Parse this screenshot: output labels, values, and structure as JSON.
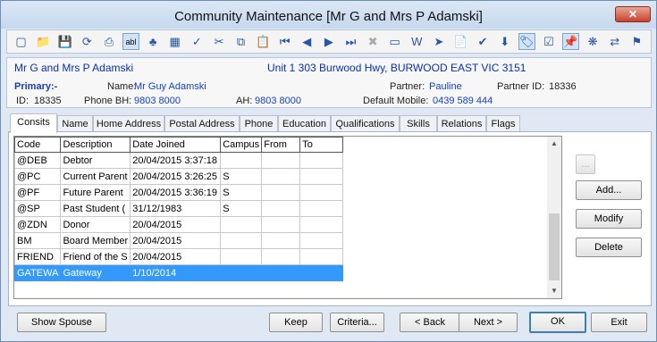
{
  "window": {
    "title": "Community Maintenance  [Mr G and Mrs P Adamski]",
    "close_label": "✕"
  },
  "toolbar": [
    {
      "name": "new-icon",
      "glyph": "▢"
    },
    {
      "name": "open-folder-icon",
      "glyph": "📁"
    },
    {
      "name": "save-icon",
      "glyph": "💾",
      "disabled": true
    },
    {
      "name": "refresh-icon",
      "glyph": "⟳"
    },
    {
      "name": "print-icon",
      "glyph": "⎙"
    },
    {
      "name": "abl-icon",
      "glyph": "abl",
      "pressed": true
    },
    {
      "name": "tree-icon",
      "glyph": "♣"
    },
    {
      "name": "calculator-icon",
      "glyph": "▦"
    },
    {
      "name": "spellcheck-icon",
      "glyph": "✓"
    },
    {
      "name": "cut-icon",
      "glyph": "✂"
    },
    {
      "name": "copy-icon",
      "glyph": "⧉"
    },
    {
      "name": "paste-icon",
      "glyph": "📋"
    },
    {
      "name": "first-record-icon",
      "glyph": "⏮"
    },
    {
      "name": "previous-record-icon",
      "glyph": "◀"
    },
    {
      "name": "next-record-icon",
      "glyph": "▶"
    },
    {
      "name": "last-record-icon",
      "glyph": "⏭"
    },
    {
      "name": "delete-icon",
      "glyph": "✖",
      "disabled": true
    },
    {
      "name": "card-icon",
      "glyph": "▭"
    },
    {
      "name": "word-document-icon",
      "glyph": "W"
    },
    {
      "name": "forward-icon",
      "glyph": "➤"
    },
    {
      "name": "clipboard-icon",
      "glyph": "📄"
    },
    {
      "name": "stamp-icon",
      "glyph": "✔"
    },
    {
      "name": "download-icon",
      "glyph": "⬇"
    },
    {
      "name": "tag-icon",
      "glyph": "🏷",
      "pressed": true
    },
    {
      "name": "checklist-icon",
      "glyph": "☑"
    },
    {
      "name": "pin-icon",
      "glyph": "📌",
      "pressed": true
    },
    {
      "name": "group-icon",
      "glyph": "❋"
    },
    {
      "name": "group-swap-icon",
      "glyph": "⇄"
    },
    {
      "name": "flag-icon",
      "glyph": "⚑"
    }
  ],
  "info": {
    "name": "Mr G and Mrs P Adamski",
    "address": "Unit 1 303 Burwood Hwy, BURWOOD EAST VIC 3151",
    "primary_label": "Primary:-",
    "name_label": "Name:",
    "name_value": "Mr Guy Adamski",
    "partner_label": "Partner:",
    "partner_value": "Pauline",
    "partner_id_label": "Partner ID:",
    "partner_id_value": "18336",
    "id_label": "ID:",
    "id_value": "18335",
    "phone_bh_label": "Phone BH:",
    "phone_bh_value": "9803 8000",
    "ah_label": "AH:",
    "ah_value": "9803 8000",
    "mobile_label": "Default Mobile:",
    "mobile_value": "0439 589 444"
  },
  "tabs": [
    "Consits",
    "Name",
    "Home Address",
    "Postal Address",
    "Phone",
    "Education",
    "Qualifications",
    "Skills",
    "Relations",
    "Flags"
  ],
  "table": {
    "columns": [
      "Code",
      "Description",
      "Date Joined",
      "Campus",
      "From",
      "To"
    ],
    "rows": [
      [
        "@DEB",
        "Debtor",
        "20/04/2015 3:37:18",
        "",
        "",
        ""
      ],
      [
        "@PC",
        "Current Parent",
        "20/04/2015 3:26:25",
        "S",
        "",
        ""
      ],
      [
        "@PF",
        "Future Parent",
        "20/04/2015 3:36:19",
        "S",
        "",
        ""
      ],
      [
        "@SP",
        "Past Student  (",
        "31/12/1983",
        "S",
        "",
        ""
      ],
      [
        "@ZDN",
        "Donor",
        "20/04/2015",
        "",
        "",
        ""
      ],
      [
        "BM",
        "Board Member",
        "20/04/2015",
        "",
        "",
        ""
      ],
      [
        "FRIEND",
        "Friend of the S",
        "20/04/2015",
        "",
        "",
        ""
      ],
      [
        "GATEWA",
        "Gateway",
        "1/10/2014",
        "",
        "",
        ""
      ]
    ],
    "selected_row": 7
  },
  "side_buttons": {
    "ellipsis": "...",
    "add": "Add...",
    "modify": "Modify",
    "delete": "Delete"
  },
  "footer": {
    "show_spouse": "Show Spouse",
    "keep": "Keep",
    "criteria": "Criteria...",
    "back": "< Back",
    "next": "Next >",
    "ok": "OK",
    "exit": "Exit"
  }
}
